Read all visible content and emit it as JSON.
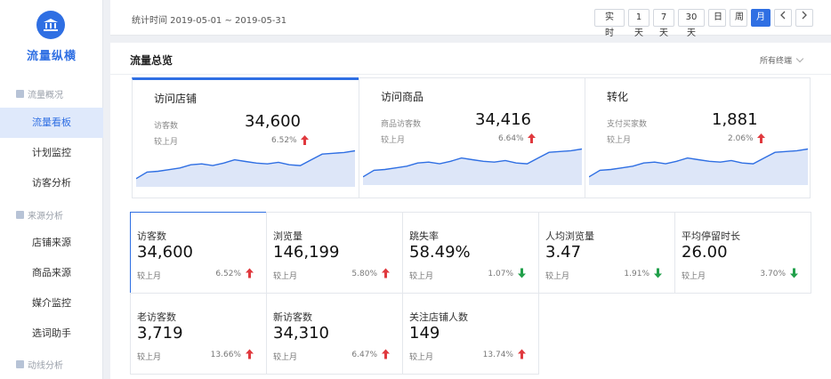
{
  "sidebar": {
    "logo_text": "流量纵横",
    "groups": [
      {
        "label": "流量概况",
        "items": [
          "流量看板",
          "计划监控",
          "访客分析"
        ]
      },
      {
        "label": "来源分析",
        "items": [
          "店铺来源",
          "商品来源",
          "媒介监控",
          "选词助手"
        ]
      },
      {
        "label": "动线分析",
        "items": []
      }
    ],
    "active_item": "流量看板"
  },
  "toolbar": {
    "date_range": "统计时间 2019-05-01 ~ 2019-05-31",
    "buttons": [
      "实 时",
      "1天",
      "7天",
      "30天",
      "日",
      "周",
      "月"
    ],
    "active_button": "月",
    "prev_icon": "chevron-left-icon",
    "next_icon": "chevron-right-icon"
  },
  "section": {
    "title": "流量总览",
    "terminal_select": "所有终端"
  },
  "overview_cards": [
    {
      "title": "访问店铺",
      "label": "访客数",
      "value": "34,600",
      "compare_label": "较上月",
      "change": "6.52%",
      "trend": "up",
      "series": [
        10,
        18,
        19,
        21,
        23,
        27,
        28,
        26,
        29,
        33,
        31,
        29,
        28,
        30,
        27,
        26,
        33,
        40,
        41,
        42,
        44
      ]
    },
    {
      "title": "访问商品",
      "label": "商品访客数",
      "value": "34,416",
      "compare_label": "较上月",
      "change": "6.64%",
      "trend": "up",
      "series": [
        10,
        18,
        19,
        21,
        23,
        27,
        28,
        26,
        29,
        33,
        31,
        29,
        28,
        30,
        27,
        26,
        33,
        40,
        41,
        42,
        44
      ]
    },
    {
      "title": "转化",
      "label": "支付买家数",
      "value": "1,881",
      "compare_label": "较上月",
      "change": "2.06%",
      "trend": "up",
      "series": [
        10,
        18,
        19,
        21,
        23,
        27,
        28,
        26,
        29,
        33,
        31,
        29,
        28,
        30,
        27,
        26,
        33,
        40,
        41,
        42,
        44
      ]
    }
  ],
  "metrics": [
    {
      "label": "访客数",
      "value": "34,600",
      "compare_label": "较上月",
      "change": "6.52%",
      "trend": "up"
    },
    {
      "label": "浏览量",
      "value": "146,199",
      "compare_label": "较上月",
      "change": "5.80%",
      "trend": "up"
    },
    {
      "label": "跳失率",
      "value": "58.49%",
      "compare_label": "较上月",
      "change": "1.07%",
      "trend": "down"
    },
    {
      "label": "人均浏览量",
      "value": "3.47",
      "compare_label": "较上月",
      "change": "1.91%",
      "trend": "down"
    },
    {
      "label": "平均停留时长",
      "value": "26.00",
      "compare_label": "较上月",
      "change": "3.70%",
      "trend": "down"
    },
    {
      "label": "老访客数",
      "value": "3,719",
      "compare_label": "较上月",
      "change": "13.66%",
      "trend": "up"
    },
    {
      "label": "新访客数",
      "value": "34,310",
      "compare_label": "较上月",
      "change": "6.47%",
      "trend": "up"
    },
    {
      "label": "关注店铺人数",
      "value": "149",
      "compare_label": "较上月",
      "change": "13.74%",
      "trend": "up"
    }
  ],
  "colors": {
    "accent": "#2f6fe3",
    "up": "#e0393e",
    "down": "#22a04b",
    "area": "#dde6f8"
  }
}
